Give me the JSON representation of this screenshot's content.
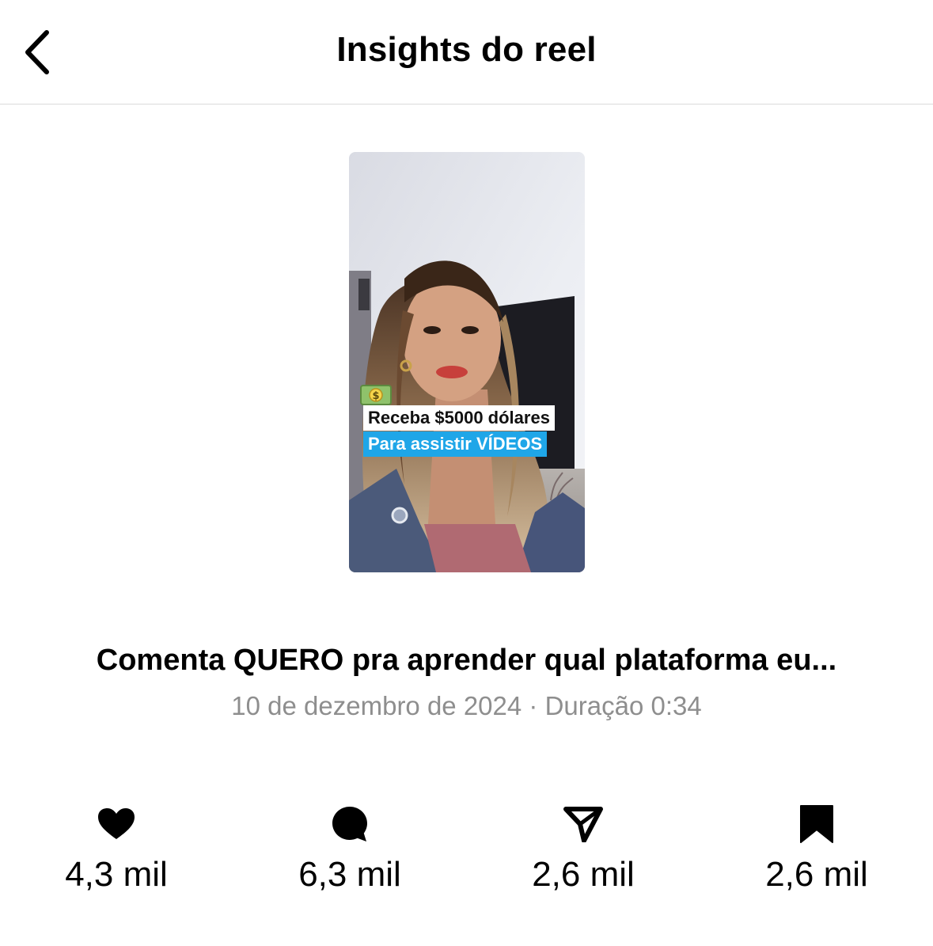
{
  "header": {
    "title": "Insights do reel",
    "back_icon": "chevron-left-icon"
  },
  "reel": {
    "caption_line1": "Receba $5000 dólares",
    "caption_line2": "Para assistir VÍDEOS",
    "caption_line2_bg": "#1fa6e8",
    "money_icon": "dollar-banknote-icon"
  },
  "post": {
    "title": "Comenta QUERO pra aprender qual plataforma eu...",
    "meta": "10 de dezembro de 2024 · Duração 0:34"
  },
  "stats": {
    "likes": {
      "icon": "heart-icon",
      "value": "4,3 mil"
    },
    "comments": {
      "icon": "comment-icon",
      "value": "6,3 mil"
    },
    "shares": {
      "icon": "send-icon",
      "value": "2,6 mil"
    },
    "saves": {
      "icon": "bookmark-icon",
      "value": "2,6 mil"
    }
  }
}
